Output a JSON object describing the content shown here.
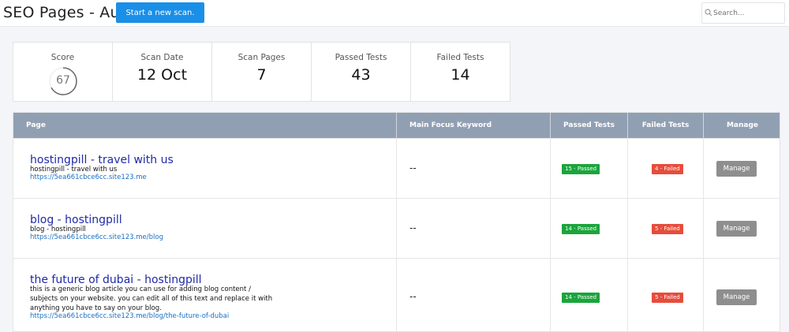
{
  "header": {
    "title": "SEO Pages - Audit",
    "scan_button": "Start a new scan.",
    "search_placeholder": "Search..."
  },
  "stats": {
    "score": {
      "label": "Score",
      "value": "67",
      "percent": 67
    },
    "scan_date": {
      "label": "Scan Date",
      "value": "12 Oct"
    },
    "scan_pages": {
      "label": "Scan Pages",
      "value": "7"
    },
    "passed_tests": {
      "label": "Passed Tests",
      "value": "43"
    },
    "failed_tests": {
      "label": "Failed Tests",
      "value": "14"
    }
  },
  "table": {
    "columns": [
      "Page",
      "Main Focus Keyword",
      "Passed Tests",
      "Failed Tests",
      "Manage"
    ],
    "rows": [
      {
        "title": "hostingpill - travel with us",
        "description": "hostingpill - travel with us",
        "url": "https://5ea661cbce6cc.site123.me",
        "keyword": "--",
        "passed": "15 - Passed",
        "failed": "4 - Failed",
        "manage": "Manage"
      },
      {
        "title": "blog - hostingpill",
        "description": "blog - hostingpill",
        "url": "https://5ea661cbce6cc.site123.me/blog",
        "keyword": "--",
        "passed": "14 - Passed",
        "failed": "5 - Failed",
        "manage": "Manage"
      },
      {
        "title": "the future of dubai - hostingpill",
        "description": "this is a generic blog article you can use for adding blog content / subjects on your website. you can edit all of this text and replace it with anything you have to say on your blog.",
        "url": "https://5ea661cbce6cc.site123.me/blog/the-future-of-dubai",
        "keyword": "--",
        "passed": "14 - Passed",
        "failed": "5 - Failed",
        "manage": "Manage"
      }
    ]
  },
  "colors": {
    "accent": "#1a8fe8",
    "header_bg": "#919fb3",
    "pass": "#1aa53c",
    "fail": "#e74c3c",
    "link": "#1f2aa8"
  }
}
